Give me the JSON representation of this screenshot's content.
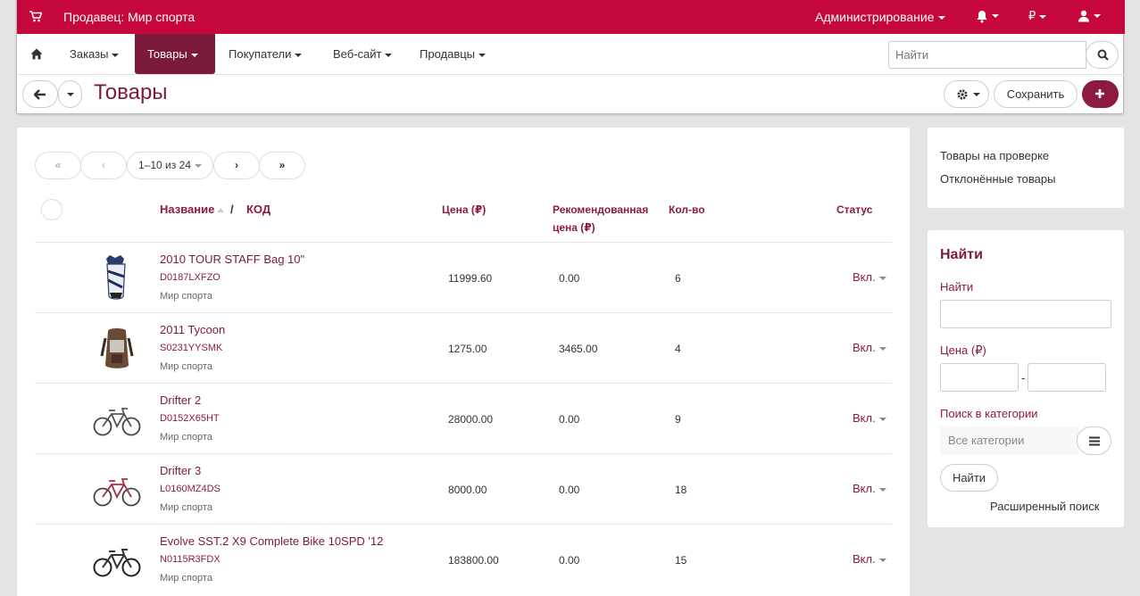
{
  "topbar": {
    "vendor": "Продавец: Мир спорта",
    "admin": "Администрирование",
    "currency": "₽"
  },
  "nav": {
    "items": [
      "Заказы",
      "Товары",
      "Покупатели",
      "Веб-сайт",
      "Продавцы"
    ],
    "active": "Товары",
    "search_placeholder": "Найти"
  },
  "page": {
    "title": "Товары",
    "save_label": "Сохранить"
  },
  "pagination": {
    "range": "1–10 из 24"
  },
  "table": {
    "headers": {
      "name": "Название",
      "slash": "/",
      "code": "КОД",
      "price": "Цена (₽)",
      "recommended": "Рекомендованная цена (₽)",
      "qty": "Кол-во",
      "status": "Статус"
    },
    "rows": [
      {
        "name": "2010 TOUR STAFF Bag 10\"",
        "code": "D0187LXFZO",
        "vendor": "Мир спорта",
        "price": "11999.60",
        "rec_price": "0.00",
        "qty": "6",
        "status": "Вкл.",
        "icon": "golf-bag-image"
      },
      {
        "name": "2011 Tycoon",
        "code": "S0231YYSMK",
        "vendor": "Мир спорта",
        "price": "1275.00",
        "rec_price": "3465.00",
        "qty": "4",
        "status": "Вкл.",
        "icon": "backpack-image"
      },
      {
        "name": "Drifter 2",
        "code": "D0152X65HT",
        "vendor": "Мир спорта",
        "price": "28000.00",
        "rec_price": "0.00",
        "qty": "9",
        "status": "Вкл.",
        "icon": "bicycle-image"
      },
      {
        "name": "Drifter 3",
        "code": "L0160MZ4DS",
        "vendor": "Мир спорта",
        "price": "8000.00",
        "rec_price": "0.00",
        "qty": "18",
        "status": "Вкл.",
        "icon": "bicycle-image"
      },
      {
        "name": "Evolve SST.2 X9 Complete Bike 10SPD '12",
        "code": "N0115R3FDX",
        "vendor": "Мир спорта",
        "price": "183800.00",
        "rec_price": "0.00",
        "qty": "15",
        "status": "Вкл.",
        "icon": "bicycle-image"
      }
    ]
  },
  "sidebar": {
    "links": [
      "Товары на проверке",
      "Отклонённые товары"
    ],
    "search": {
      "heading": "Найти",
      "find_label": "Найти",
      "price_label": "Цена (₽)",
      "price_separator": "-",
      "category_label": "Поиск в категории",
      "category_placeholder": "Все категории",
      "find_button": "Найти",
      "advanced": "Расширенный поиск"
    }
  },
  "colors": {
    "brand": "#c5073e",
    "active_nav": "#7b1a3a",
    "link": "#8c1a41"
  }
}
